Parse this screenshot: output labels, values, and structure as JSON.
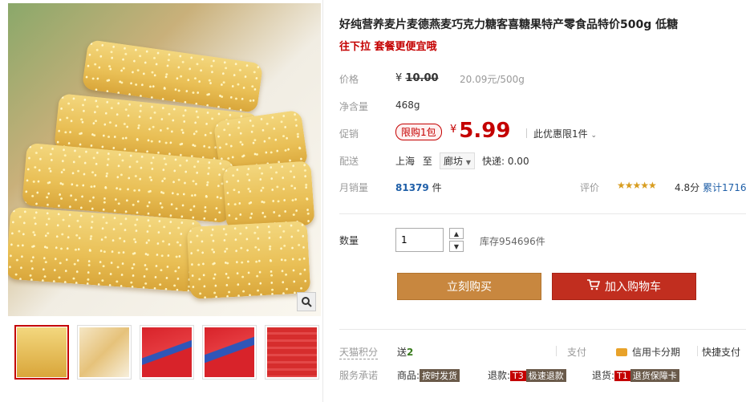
{
  "product": {
    "title": "好纯营养麦片麦德燕麦巧克力糖客喜糖果特产零食品特价500g 低糖",
    "subtitle": "往下拉 套餐更便宜哦"
  },
  "price": {
    "label": "价格",
    "currency": "¥",
    "original": "10.00",
    "unit_price": "20.09元/500g"
  },
  "net_weight": {
    "label": "净含量",
    "value": "468g"
  },
  "promo": {
    "label": "促销",
    "limit_badge": "限购1包",
    "currency": "¥",
    "price": "5.99",
    "note": "此优惠限1件"
  },
  "shipping": {
    "label": "配送",
    "from": "上海",
    "to_word": "至",
    "destination": "廊坊",
    "fee": "快递: 0.00"
  },
  "sales": {
    "label": "月销量",
    "count": "81379",
    "unit": "件",
    "review_label": "评价",
    "stars": "★★★★★",
    "rating": 4.8,
    "score": "4.8分",
    "cumulative": "累计1716"
  },
  "quantity": {
    "label": "数量",
    "value": "1",
    "stock": "库存954696件"
  },
  "buttons": {
    "buy_now": "立刻购买",
    "add_cart": "加入购物车"
  },
  "tmall": {
    "points_label": "天猫积分",
    "points_prefix": "送",
    "points_value": "2",
    "pay_label": "支付",
    "pay_card": "信用卡分期",
    "pay_quick": "快捷支付"
  },
  "service": {
    "label": "服务承诺",
    "goods_label": "商品:",
    "goods_tag": "按时发货",
    "refund_label": "退款:",
    "refund_code": "T3",
    "refund_tag": "极速退款",
    "return_label": "退货:",
    "return_code": "T1",
    "return_tag": "退货保障卡"
  },
  "icons": {
    "zoom": "magnifier-icon",
    "cart": "cart-icon",
    "card": "credit-card-icon",
    "dropdown": "chevron-down-icon"
  },
  "colors": {
    "price_red": "#c40000",
    "buy_button": "#c8873f",
    "cart_button": "#c12e1f",
    "link_blue": "#1f5fa8",
    "star": "#d89d1f"
  }
}
